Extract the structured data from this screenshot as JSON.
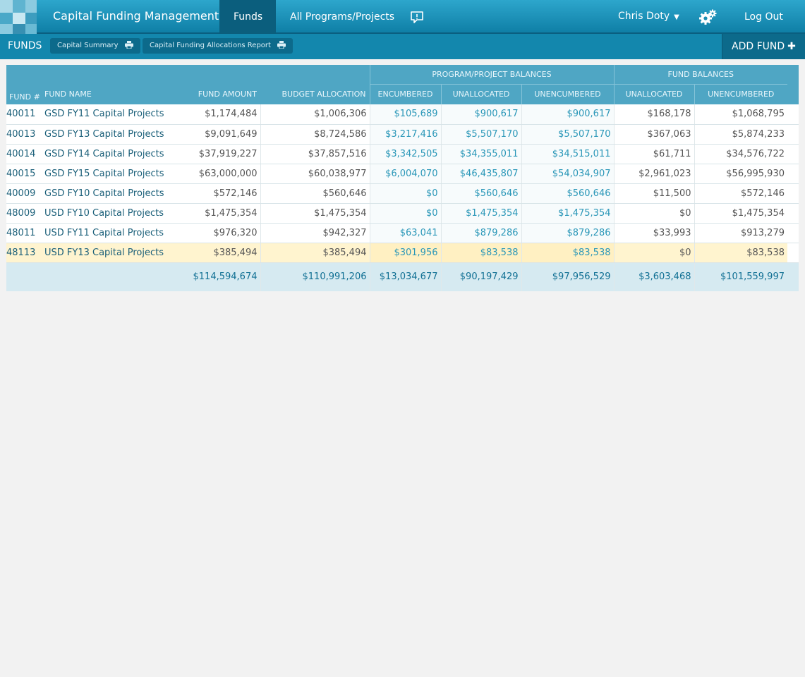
{
  "app": {
    "title": "Capital Funding Management",
    "nav": {
      "funds": "Funds",
      "programs": "All Programs/Projects"
    },
    "user": {
      "name": "Chris Doty",
      "caret": "▼"
    },
    "logout": "Log Out"
  },
  "subbar": {
    "title": "FUNDS",
    "buttons": {
      "summary": "Capital Summary",
      "allocations": "Capital Funding Allocations Report"
    },
    "add_fund": "ADD FUND"
  },
  "colors": {
    "accent": "#1387ad",
    "header": "#4fa6c4",
    "highlight": "#fff4cf"
  },
  "table": {
    "group_headers": {
      "program": "PROGRAM/PROJECT BALANCES",
      "fund": "FUND BALANCES"
    },
    "columns": {
      "fund_no": "FUND #",
      "fund_name": "FUND NAME",
      "fund_amount": "FUND AMOUNT",
      "budget_allocation": "BUDGET ALLOCATION",
      "pp_encumbered": "ENCUMBERED",
      "pp_unallocated": "UNALLOCATED",
      "pp_unencumbered": "UNENCUMBERED",
      "fb_unallocated": "UNALLOCATED",
      "fb_unencumbered": "UNENCUMBERED"
    },
    "rows": [
      {
        "id": "40011",
        "name": "GSD FY11 Capital Projects",
        "amount": "$1,174,484",
        "budget": "$1,006,306",
        "enc": "$105,689",
        "unalloc": "$900,617",
        "unenc": "$900,617",
        "f_unalloc": "$168,178",
        "f_unenc": "$1,068,795"
      },
      {
        "id": "40013",
        "name": "GSD FY13 Capital Projects",
        "amount": "$9,091,649",
        "budget": "$8,724,586",
        "enc": "$3,217,416",
        "unalloc": "$5,507,170",
        "unenc": "$5,507,170",
        "f_unalloc": "$367,063",
        "f_unenc": "$5,874,233"
      },
      {
        "id": "40014",
        "name": "GSD FY14 Capital Projects",
        "amount": "$37,919,227",
        "budget": "$37,857,516",
        "enc": "$3,342,505",
        "unalloc": "$34,355,011",
        "unenc": "$34,515,011",
        "f_unalloc": "$61,711",
        "f_unenc": "$34,576,722"
      },
      {
        "id": "40015",
        "name": "GSD FY15 Capital Projects",
        "amount": "$63,000,000",
        "budget": "$60,038,977",
        "enc": "$6,004,070",
        "unalloc": "$46,435,807",
        "unenc": "$54,034,907",
        "f_unalloc": "$2,961,023",
        "f_unenc": "$56,995,930"
      },
      {
        "id": "40009",
        "name": "GSD FY10 Capital Projects",
        "amount": "$572,146",
        "budget": "$560,646",
        "enc": "$0",
        "unalloc": "$560,646",
        "unenc": "$560,646",
        "f_unalloc": "$11,500",
        "f_unenc": "$572,146"
      },
      {
        "id": "48009",
        "name": "USD FY10 Capital Projects",
        "amount": "$1,475,354",
        "budget": "$1,475,354",
        "enc": "$0",
        "unalloc": "$1,475,354",
        "unenc": "$1,475,354",
        "f_unalloc": "$0",
        "f_unenc": "$1,475,354"
      },
      {
        "id": "48011",
        "name": "USD FY11 Capital Projects",
        "amount": "$976,320",
        "budget": "$942,327",
        "enc": "$63,041",
        "unalloc": "$879,286",
        "unenc": "$879,286",
        "f_unalloc": "$33,993",
        "f_unenc": "$913,279"
      },
      {
        "id": "48113",
        "name": "USD FY13 Capital Projects",
        "amount": "$385,494",
        "budget": "$385,494",
        "enc": "$301,956",
        "unalloc": "$83,538",
        "unenc": "$83,538",
        "f_unalloc": "$0",
        "f_unenc": "$83,538"
      }
    ],
    "totals": {
      "amount": "$114,594,674",
      "budget": "$110,991,206",
      "enc": "$13,034,677",
      "unalloc": "$90,197,429",
      "unenc": "$97,956,529",
      "f_unalloc": "$3,603,468",
      "f_unenc": "$101,559,997"
    }
  }
}
